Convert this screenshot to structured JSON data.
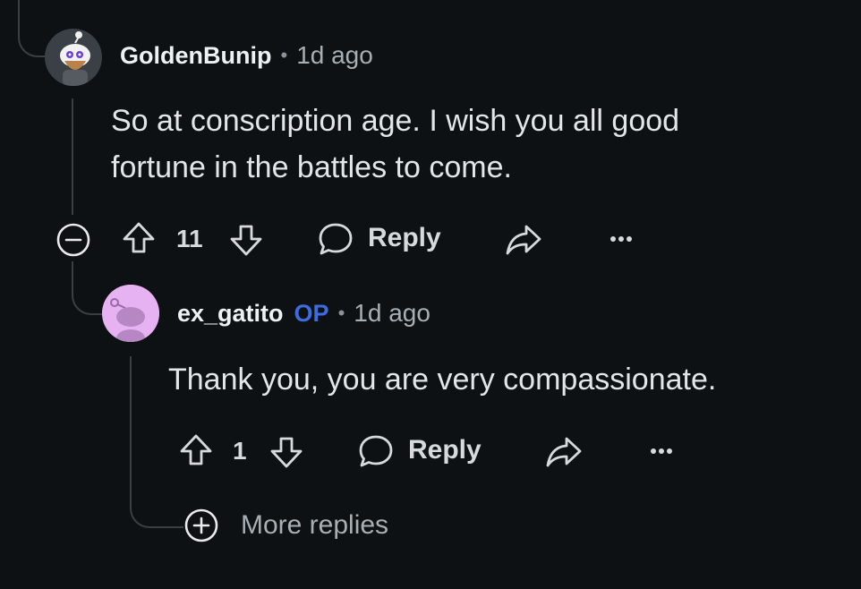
{
  "comments": [
    {
      "author": "GoldenBunip",
      "separator": "•",
      "timestamp": "1d ago",
      "body_lines": [
        "So at conscription age. I wish you all good",
        "fortune in the battles to come."
      ],
      "score": "11",
      "reply_label": "Reply"
    },
    {
      "author": "ex_gatito",
      "op_badge": "OP",
      "separator": "•",
      "timestamp": "1d ago",
      "body_lines": [
        "Thank you, you are very compassionate."
      ],
      "score": "1",
      "reply_label": "Reply"
    }
  ],
  "more_replies_label": "More replies",
  "colors": {
    "background": "#0e1113",
    "op_badge": "#3f6be0",
    "thread_line": "#3a3f44",
    "avatar_2_bg": "#e7b2f1"
  },
  "icons": [
    "collapse-icon",
    "upvote-icon",
    "downvote-icon",
    "comment-bubble-icon",
    "share-icon",
    "more-options-icon",
    "expand-icon"
  ]
}
